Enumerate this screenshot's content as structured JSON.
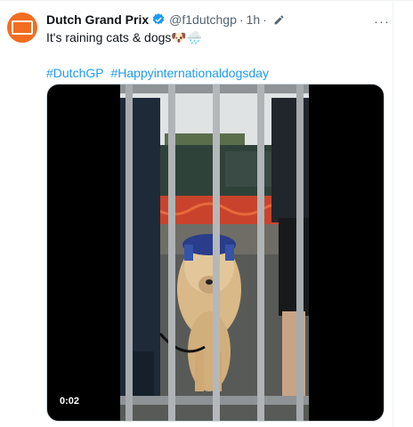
{
  "account": {
    "name": "Dutch Grand Prix",
    "handle": "@f1dutchgp",
    "separator": "·",
    "time": "1h",
    "verified_color": "#1d9bf0",
    "avatar_color": "#f26d21"
  },
  "tweet": {
    "text": "It's raining cats & dogs🐶🌧️",
    "hashtags": [
      "#DutchGP",
      "#Happyinternationaldogsday"
    ]
  },
  "media": {
    "duration": "0:02"
  },
  "icons": {
    "verified": "verified-badge-icon",
    "edit": "edited-pencil-icon",
    "more": "more-options-icon"
  },
  "more_label": "···"
}
